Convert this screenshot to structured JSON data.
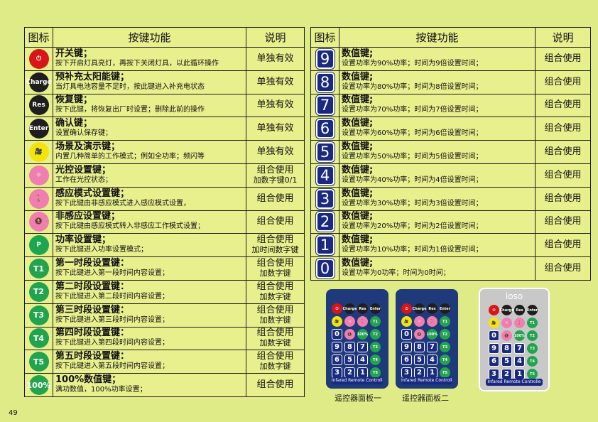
{
  "headers": {
    "icon": "图标",
    "func": "按键功能",
    "note": "说明"
  },
  "left_rows": [
    {
      "icon": "⏻",
      "icon_name": "power-icon",
      "title": "开关键；",
      "desc": "按下开启灯具亮灯，再按下关闭灯具，以此循环操作",
      "note1": "单独有效",
      "note2": ""
    },
    {
      "icon": "Charge",
      "icon_name": "charge-icon",
      "title": "预补充太阳能键；",
      "desc": "当灯具电池容量不足时，按此键进入补充电状态",
      "note1": "单独有效",
      "note2": ""
    },
    {
      "icon": "Res",
      "icon_name": "reset-icon",
      "title": "恢复键；",
      "desc": "按下此键，将恢复出厂时设置；删除此前的操作",
      "note1": "单独有效",
      "note2": ""
    },
    {
      "icon": "Enter",
      "icon_name": "enter-icon",
      "title": "确认键；",
      "desc": "设置确认保存键；",
      "note1": "单独有效",
      "note2": ""
    },
    {
      "icon": "🎥",
      "icon_name": "camera-icon",
      "title": "场景及演示键；",
      "desc": "内置几种简单的工作模式；例如全功率；频闪等",
      "note1": "单独有效",
      "note2": ""
    },
    {
      "icon": "☼",
      "icon_name": "light-sensor-icon",
      "title": "光控设置键；",
      "desc": "工作在光控状态；",
      "note1": "组合使用",
      "note2": "加数字键0/1"
    },
    {
      "icon": "🚶",
      "icon_name": "motion-sensor-icon",
      "title": "感应模式设置键；",
      "desc": "按下此键由非感应模式进入感应模式设置，",
      "note1": "组合使用",
      "note2": ""
    },
    {
      "icon": "🚷",
      "icon_name": "no-motion-icon",
      "title": "非感应设置键；",
      "desc": "按下此键由感应模式转入非感应工作模式设置；",
      "note1": "组合使用",
      "note2": ""
    },
    {
      "icon": "P",
      "icon_name": "power-rate-icon",
      "title": "功率设置键；",
      "desc": "按下此键进入功率设置模式；",
      "note1": "组合使用",
      "note2": "加时间数字键"
    },
    {
      "icon": "T1",
      "icon_name": "t1-icon",
      "title": "第一时段设置键：",
      "desc": "按下此键进入第一段时间内容设置；",
      "note1": "组合使用",
      "note2": "加数字键"
    },
    {
      "icon": "T2",
      "icon_name": "t2-icon",
      "title": "第二时段设置键：",
      "desc": "按下此键进入第二段时间内容设置；",
      "note1": "组合使用",
      "note2": "加数字键"
    },
    {
      "icon": "T3",
      "icon_name": "t3-icon",
      "title": "第三时段设置键：",
      "desc": "按下此键进入第三段时间内容设置；",
      "note1": "组合使用",
      "note2": "加数字键"
    },
    {
      "icon": "T4",
      "icon_name": "t4-icon",
      "title": "第四时段设置键：",
      "desc": "按下此键进入第四段时间内容设置；",
      "note1": "组合使用",
      "note2": "加数字键"
    },
    {
      "icon": "T5",
      "icon_name": "t5-icon",
      "title": "第五时段设置键：",
      "desc": "按下此键进入第五段时间内容设置；",
      "note1": "组合使用",
      "note2": "加数字键"
    },
    {
      "icon": "100%",
      "icon_name": "full-power-icon",
      "title": "100%数值键；",
      "desc": "满功数值，100%功率设置；",
      "note1": "组合使用",
      "note2": ""
    }
  ],
  "right_rows": [
    {
      "icon": "9",
      "title": "数值键;",
      "desc": "设置功率为90%功率；时间为9倍设置时间；",
      "note": "组合使用"
    },
    {
      "icon": "8",
      "title": "数值键;",
      "desc": "设置功率为80%功率；时间为8倍设置时间；",
      "note": "组合使用"
    },
    {
      "icon": "7",
      "title": "数值键;",
      "desc": "设置功率为70%功率；时间为7倍设置时间；",
      "note": "组合使用"
    },
    {
      "icon": "6",
      "title": "数值键;",
      "desc": "设置功率为60%功率；时间为6倍设置时间；",
      "note": "组合使用"
    },
    {
      "icon": "5",
      "title": "数值键;",
      "desc": "设置功率为50%功率；时间为5倍设置时间；",
      "note": "组合使用"
    },
    {
      "icon": "4",
      "title": "数值键;",
      "desc": "设置功率为40%功率；时间为4倍设置时间；",
      "note": "组合使用"
    },
    {
      "icon": "3",
      "title": "数值键;",
      "desc": "设置功率为30%功率；时间为3倍设置时间；",
      "note": "组合使用"
    },
    {
      "icon": "2",
      "title": "数值键;",
      "desc": "设置功率为20%功率；时间为2倍设置时间；",
      "note": "组合使用"
    },
    {
      "icon": "1",
      "title": "数值键;",
      "desc": "设置功率为10%功率；时间为1倍设置时间；",
      "note": "组合使用"
    },
    {
      "icon": "0",
      "title": "数值键;",
      "desc": "设置功率为0功率；时间为0时间；",
      "note": "组合使用"
    }
  ],
  "remotes": {
    "footer_label": "Infared Remote Controller",
    "footer_label_3": "Infared Remote Controlle",
    "brand": "loso",
    "keys": [
      "⏻",
      "Charge",
      "Res",
      "Enter",
      "🎥",
      "☼",
      "🚶",
      "T1",
      "0",
      "🚷",
      "100%",
      "T2",
      "9",
      "8",
      "7",
      "T3",
      "6",
      "5",
      "4",
      "T4",
      "3",
      "2",
      "1",
      "T5"
    ],
    "caption_1": "遥控器面板一",
    "caption_2": "遥控器面板二"
  },
  "page_number": "49"
}
